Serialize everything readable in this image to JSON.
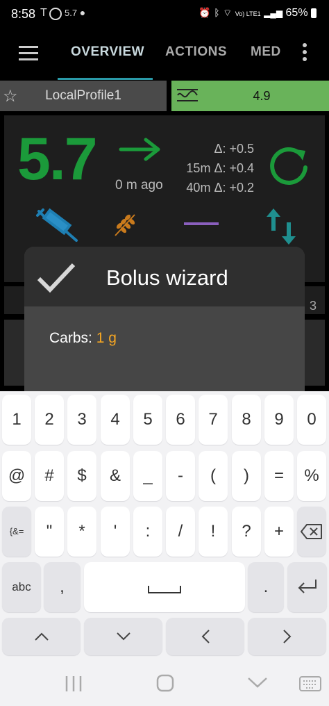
{
  "status": {
    "time": "8:58",
    "left_icons": "5.7",
    "network": "Vo) LTE1",
    "battery": "65%"
  },
  "appbar": {
    "tabs": [
      "OVERVIEW",
      "ACTIONS",
      "MED"
    ]
  },
  "profile": {
    "name": "LocalProfile1",
    "target": "4.9"
  },
  "glucose": {
    "value": "5.7",
    "ago": "0 m ago",
    "delta": "Δ: +0.5",
    "delta15": "15m Δ: +0.4",
    "delta40": "40m Δ: +0.2",
    "colors": {
      "bg": "#1b9a3a",
      "basal": "#8a5fbd"
    }
  },
  "hidden_row": {
    "value": "3"
  },
  "dialog": {
    "title": "Bolus wizard",
    "carbs_label": "Carbs:",
    "carbs_value": "1 g",
    "accent": "#f5a623"
  },
  "keyboard": {
    "row1": [
      "1",
      "2",
      "3",
      "4",
      "5",
      "6",
      "7",
      "8",
      "9",
      "0"
    ],
    "row2": [
      "@",
      "#",
      "$",
      "&",
      "_",
      "-",
      "(",
      ")",
      "=",
      "%"
    ],
    "row3": [
      "{&=",
      "\"",
      "*",
      "'",
      ":",
      "/",
      "!",
      "?",
      "+"
    ],
    "row4": {
      "abc": "abc",
      "comma": ",",
      "period": "."
    },
    "icons": {
      "backspace": "backspace-icon",
      "enter": "enter-icon",
      "space": "space-icon"
    }
  },
  "nav": {
    "icons": [
      "recent-apps-icon",
      "home-icon",
      "back-icon",
      "keyboard-icon"
    ]
  }
}
